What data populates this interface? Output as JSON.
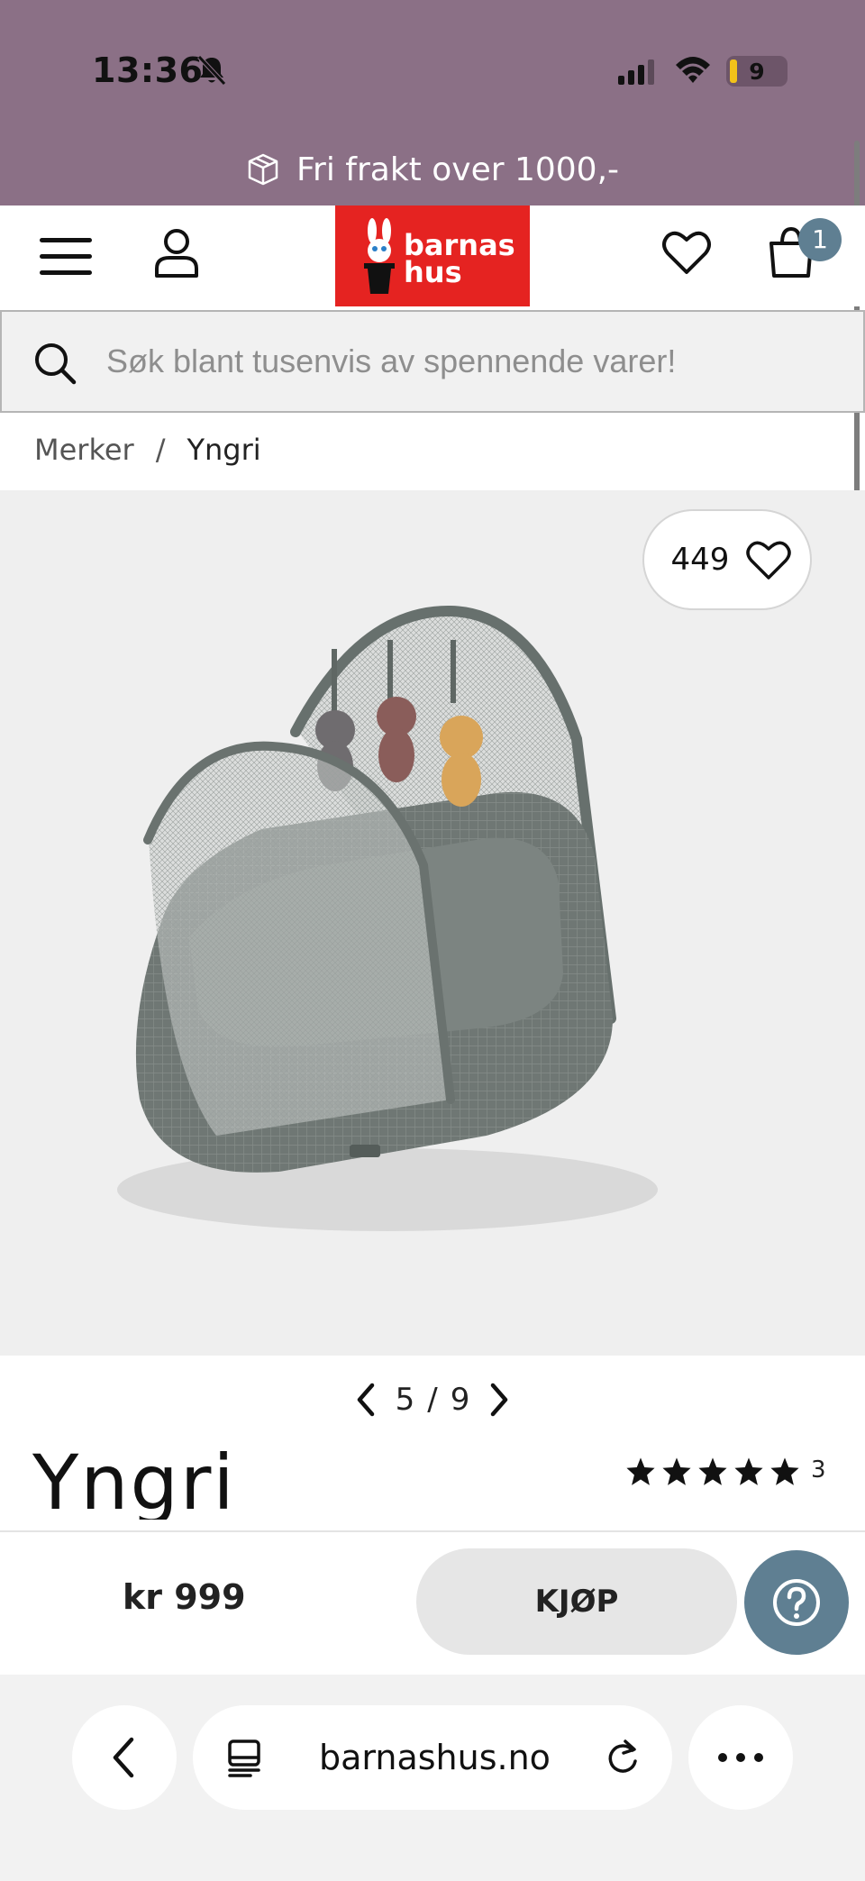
{
  "status_bar": {
    "time": "13:36",
    "battery_level": "9",
    "battery_color": "#f2c21a",
    "icons": [
      "bell-slash-icon",
      "signal-icon",
      "wifi-icon",
      "battery-icon"
    ]
  },
  "promo": {
    "text": "Fri frakt over 1000,-",
    "icon": "package-icon",
    "background": "#8b7086"
  },
  "header": {
    "logo_line1": "barnas",
    "logo_line2": "hus",
    "logo_color": "#e52321",
    "cart_count": "1",
    "badge_color": "#5f7f92",
    "icons": [
      "menu-icon",
      "user-icon",
      "heart-icon",
      "cart-icon"
    ]
  },
  "search": {
    "placeholder": "Søk blant tusenvis av spennende varer!"
  },
  "breadcrumb": {
    "items": [
      "Merker",
      "Yngri"
    ],
    "separator": "/"
  },
  "gallery": {
    "favorite_count": "449",
    "current_index": "5",
    "separator": "/",
    "total": "9"
  },
  "product": {
    "brand": "Yngri",
    "rating_stars": 5,
    "review_count": "3",
    "price": "kr 999",
    "buy_label": "KJØP"
  },
  "browser": {
    "url": "barnashus.no",
    "icons": [
      "back-icon",
      "reader-icon",
      "reload-icon",
      "more-icon"
    ]
  }
}
